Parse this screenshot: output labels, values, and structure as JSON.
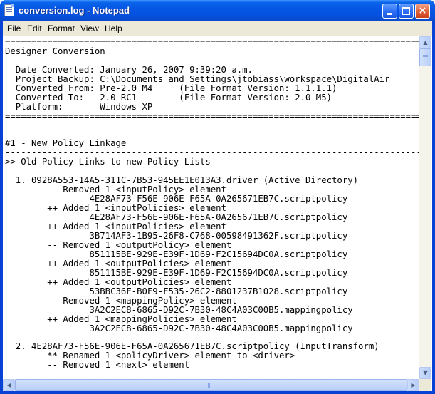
{
  "window": {
    "title": "conversion.log - Notepad",
    "icon": "notepad-icon",
    "controls": {
      "minimize": "minimize-icon",
      "maximize": "maximize-icon",
      "close_glyph": "×"
    }
  },
  "menu": [
    "File",
    "Edit",
    "Format",
    "View",
    "Help"
  ],
  "document": {
    "lines": [
      "================================================================================",
      "Designer Conversion",
      "",
      "  Date Converted: January 26, 2007 9:39:20 a.m.",
      "  Project Backup: C:\\Documents and Settings\\jtobiass\\workspace\\DigitalAir",
      "  Converted From: Pre-2.0 M4     (File Format Version: 1.1.1.1)",
      "  Converted To:   2.0 RC1        (File Format Version: 2.0 M5)",
      "  Platform:       Windows XP",
      "================================================================================",
      "",
      "--------------------------------------------------------------------------------",
      "#1 - New Policy Linkage",
      "--------------------------------------------------------------------------------",
      ">> Old Policy Links to new Policy Lists",
      "",
      "  1. 0928A553-14A5-311C-7B53-945EE1E013A3.driver (Active Directory)",
      "        -- Removed 1 <inputPolicy> element",
      "                4E28AF73-F56E-906E-F65A-0A265671EB7C.scriptpolicy",
      "        ++ Added 1 <inputPolicies> element",
      "                4E28AF73-F56E-906E-F65A-0A265671EB7C.scriptpolicy",
      "        ++ Added 1 <inputPolicies> element",
      "                3B714AF3-1B95-26F8-C768-00598491362F.scriptpolicy",
      "        -- Removed 1 <outputPolicy> element",
      "                851115BE-929E-E39F-1D69-F2C15694DC0A.scriptpolicy",
      "        ++ Added 1 <outputPolicies> element",
      "                851115BE-929E-E39F-1D69-F2C15694DC0A.scriptpolicy",
      "        ++ Added 1 <outputPolicies> element",
      "                53BBC36F-B0F9-F535-26C2-8801237B1028.scriptpolicy",
      "        -- Removed 1 <mappingPolicy> element",
      "                3A2C2EC8-6865-D92C-7B30-48C4A03C00B5.mappingpolicy",
      "        ++ Added 1 <mappingPolicies> element",
      "                3A2C2EC8-6865-D92C-7B30-48C4A03C00B5.mappingpolicy",
      "",
      "  2. 4E28AF73-F56E-906E-F65A-0A265671EB7C.scriptpolicy (InputTransform)",
      "        ** Renamed 1 <policyDriver> element to <driver>",
      "        -- Removed 1 <next> element"
    ]
  },
  "scrollbars": {
    "up_arrow": "▲",
    "down_arrow": "▼",
    "left_arrow": "◀",
    "right_arrow": "▶"
  }
}
